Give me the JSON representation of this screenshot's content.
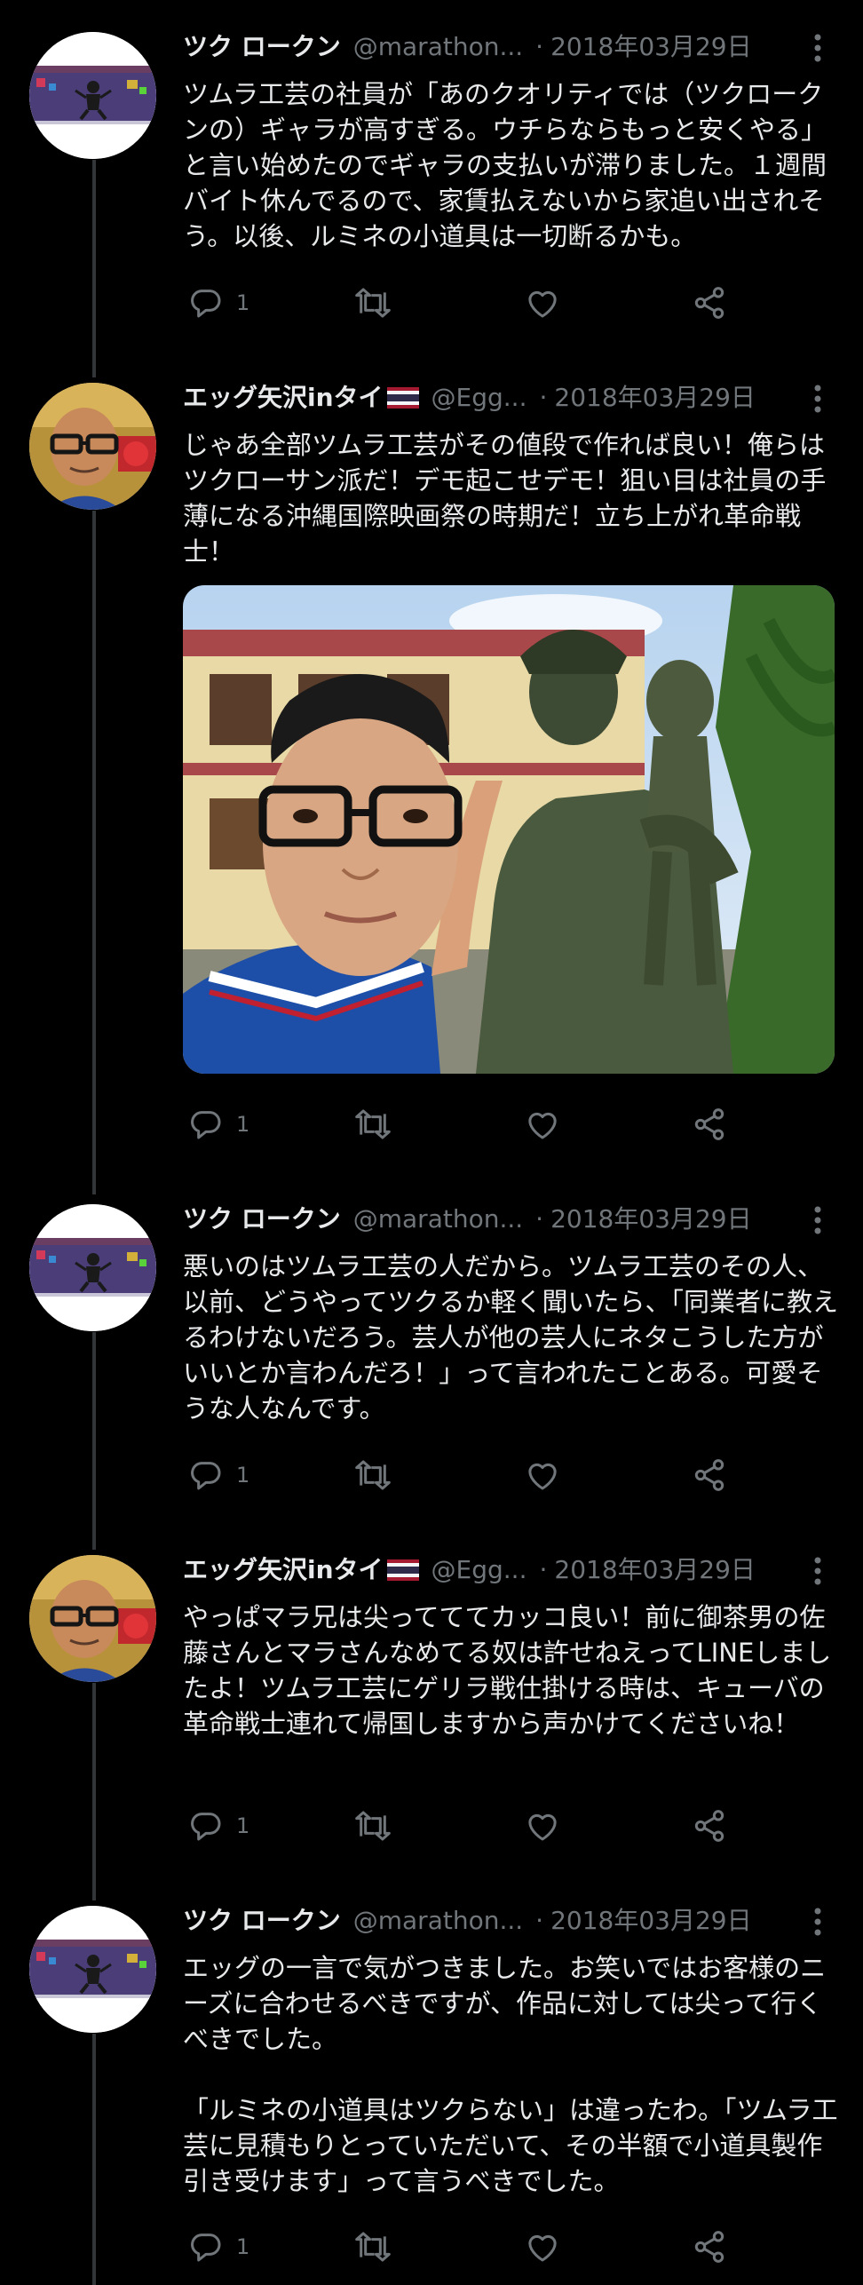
{
  "colors": {
    "background": "#000000",
    "text_primary": "#e7e9ea",
    "text_secondary": "#71767b",
    "thread_line": "#333639"
  },
  "tweets": [
    {
      "name": "ツク ロークン",
      "handle": "@marathon...",
      "dot": "·",
      "date": "2018年03月29日",
      "avatar": "tsuku-avatar",
      "text": "ツムラ工芸の社員が「あのクオリティでは（ツクロークンの）ギャラが高すぎる。ウチらならもっと安くやる」と言い始めたのでギャラの支払いが滞りました。１週間バイト休んでるので、家賃払えないから家追い出されそう。以後、ルミネの小道具は一切断るかも。",
      "reply_count": "1"
    },
    {
      "name": "エッグ矢沢inタイ",
      "handle": "@Egg...",
      "dot": "·",
      "date": "2018年03月29日",
      "avatar": "egg-avatar",
      "text": "じゃあ全部ツムラ工芸がその値段で作れば良い！俺らはツクローサン派だ！デモ起こせデモ！狙い目は社員の手薄になる沖縄国際映画祭の時期だ！立ち上がれ革命戦士！",
      "reply_count": "1"
    },
    {
      "name": "ツク ロークン",
      "handle": "@marathon...",
      "dot": "·",
      "date": "2018年03月29日",
      "avatar": "tsuku-avatar",
      "text": "悪いのはツムラ工芸の人だから。ツムラ工芸のその人、以前、どうやってツクるか軽く聞いたら、「同業者に教えるわけないだろう。芸人が他の芸人にネタこうした方がいいとか言わんだろ！」って言われたことある。可愛そうな人なんです。",
      "reply_count": "1"
    },
    {
      "name": "エッグ矢沢inタイ",
      "handle": "@Egg...",
      "dot": "·",
      "date": "2018年03月29日",
      "avatar": "egg-avatar",
      "text": "やっぱマラ兄は尖ってててカッコ良い！前に御茶男の佐藤さんとマラさんなめてる奴は許せねえってLINEしましたよ！ツムラ工芸にゲリラ戦仕掛ける時は、キューバの革命戦士連れて帰国しますから声かけてくださいね！",
      "reply_count": "1"
    },
    {
      "name": "ツク ロークン",
      "handle": "@marathon...",
      "dot": "·",
      "date": "2018年03月29日",
      "avatar": "tsuku-avatar",
      "text": "エッグの一言で気がつきました。お笑いではお客様のニーズに合わせるべきですが、作品に対しては尖って行くべきでした。\n\n「ルミネの小道具はツクらない」は違ったわ。「ツムラ工芸に見積もりとっていただいて、その半額で小道具製作引き受けます」って言うべきでした。",
      "reply_count": "1"
    }
  ],
  "icons": {
    "reply": "reply-icon",
    "retweet": "retweet-icon",
    "like": "like-icon",
    "share": "share-icon",
    "more": "more-icon",
    "flag": "thai-flag-icon"
  }
}
